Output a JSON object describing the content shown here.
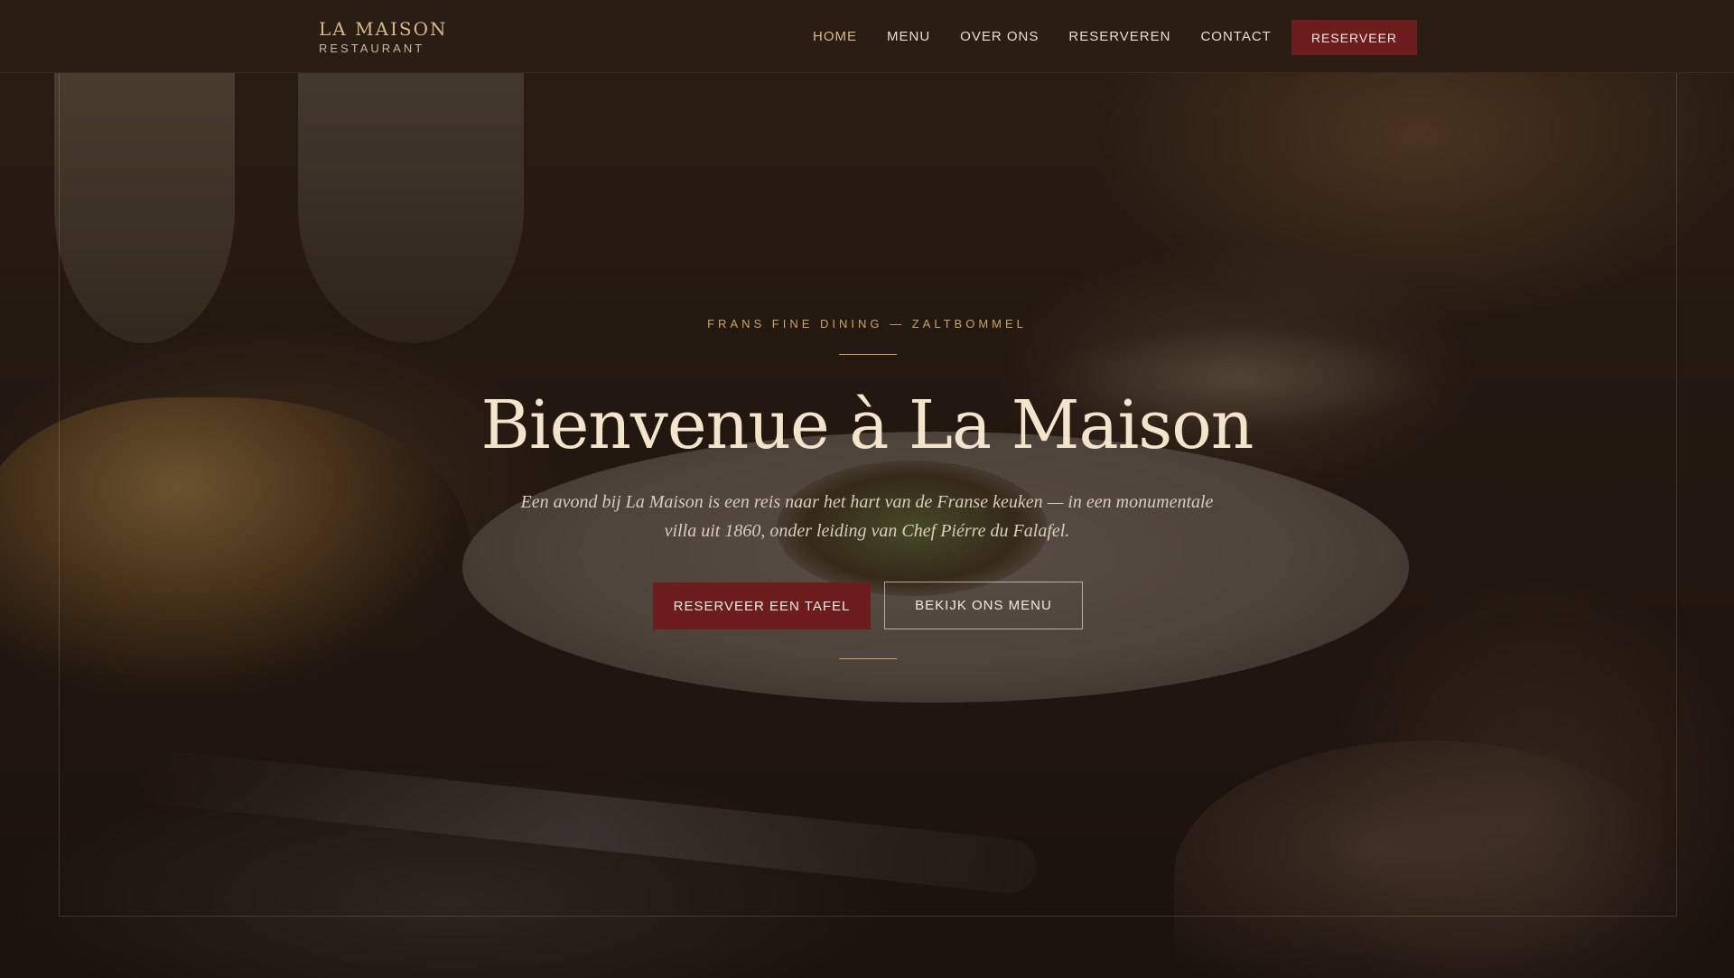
{
  "nav": {
    "brand": {
      "name": "LA MAISON",
      "subtitle": "RESTAURANT"
    },
    "links": [
      {
        "label": "HOME",
        "active": true
      },
      {
        "label": "MENU",
        "active": false
      },
      {
        "label": "OVER ONS",
        "active": false
      },
      {
        "label": "RESERVEREN",
        "active": false
      },
      {
        "label": "CONTACT",
        "active": false
      }
    ],
    "cta_label": "RESERVEER"
  },
  "hero": {
    "eyebrow": "FRANS FINE DINING — ZALTBOMMEL",
    "title": "Bienvenue à La Maison",
    "description": "Een avond bij La Maison is een reis naar het hart van de Franse keuken — in een monumentale villa uit 1860, onder leiding van Chef Piérre du Falafel.",
    "primary_button": "RESERVEER EEN TAFEL",
    "secondary_button": "BEKIJK ONS MENU"
  },
  "colors": {
    "accent_gold": "#c9a466",
    "burgundy": "#6e1d1e",
    "nav_bg": "#2a1d14",
    "title_cream": "#f3e4cc"
  }
}
